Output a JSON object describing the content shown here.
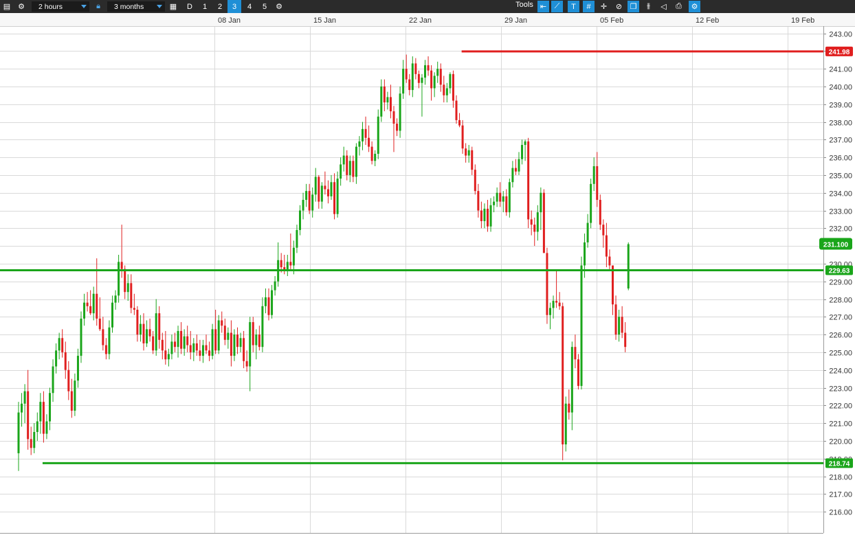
{
  "toolbar": {
    "interval": "2 hours",
    "range": "3 months",
    "periods": [
      "D",
      "1",
      "2",
      "3",
      "4",
      "5"
    ],
    "selected_period": "3",
    "tools_label": "Tools"
  },
  "colors": {
    "up": "#1aa51a",
    "down": "#e01f1f",
    "grid": "#d9d9d9"
  },
  "chart_data": {
    "type": "candlestick",
    "x_labels": [
      "08 Jan",
      "15 Jan",
      "22 Jan",
      "29 Jan",
      "05 Feb",
      "12 Feb",
      "19 Feb"
    ],
    "y_ticks": [
      "243.00",
      "242.00",
      "241.00",
      "240.00",
      "239.00",
      "238.00",
      "237.00",
      "236.00",
      "235.00",
      "234.00",
      "233.00",
      "232.00",
      "231.00",
      "230.00",
      "229.00",
      "228.00",
      "227.00",
      "226.00",
      "225.00",
      "224.00",
      "223.00",
      "222.00",
      "221.00",
      "220.00",
      "219.00",
      "218.00",
      "217.00",
      "216.00"
    ],
    "ylim": [
      215.6,
      243.3
    ],
    "horizontal_lines": [
      {
        "value": 241.98,
        "label": "241.98",
        "color": "#e01f1f",
        "start_candle": 143
      },
      {
        "value": 229.63,
        "label": "229.63",
        "color": "#1aa51a",
        "start_candle": 0
      },
      {
        "value": 218.74,
        "label": "218.74",
        "color": "#1aa51a",
        "start_candle": 9
      }
    ],
    "last_price": {
      "value": 231.1,
      "label": "231.100",
      "color": "#1aa51a"
    },
    "candles": [
      [
        219.3,
        222.2,
        218.3,
        221.6
      ],
      [
        221.6,
        222.7,
        220.8,
        222.1
      ],
      [
        222.1,
        223.2,
        221.0,
        222.8
      ],
      [
        222.8,
        224.0,
        219.5,
        220.1
      ],
      [
        220.1,
        220.8,
        219.2,
        219.6
      ],
      [
        219.6,
        221.0,
        219.3,
        220.5
      ],
      [
        220.5,
        221.6,
        220.0,
        221.1
      ],
      [
        221.1,
        222.7,
        220.4,
        222.2
      ],
      [
        222.2,
        222.8,
        219.9,
        220.4
      ],
      [
        220.4,
        221.5,
        220.1,
        221.1
      ],
      [
        221.1,
        223.0,
        220.6,
        222.7
      ],
      [
        222.7,
        224.6,
        222.2,
        224.2
      ],
      [
        224.2,
        225.5,
        223.8,
        225.1
      ],
      [
        225.1,
        226.1,
        224.6,
        225.8
      ],
      [
        225.8,
        226.3,
        224.7,
        225.0
      ],
      [
        225.0,
        225.6,
        223.5,
        224.0
      ],
      [
        224.0,
        224.5,
        222.3,
        222.8
      ],
      [
        222.8,
        223.5,
        221.3,
        221.7
      ],
      [
        221.7,
        223.8,
        221.4,
        223.4
      ],
      [
        223.4,
        225.2,
        223.0,
        224.8
      ],
      [
        224.8,
        227.3,
        224.4,
        226.9
      ],
      [
        226.9,
        228.3,
        226.5,
        227.8
      ],
      [
        227.8,
        228.4,
        227.3,
        227.6
      ],
      [
        227.6,
        228.5,
        227.1,
        227.2
      ],
      [
        227.2,
        228.7,
        226.8,
        228.3
      ],
      [
        228.3,
        230.3,
        226.5,
        226.9
      ],
      [
        226.9,
        228.1,
        226.2,
        226.3
      ],
      [
        226.3,
        227.0,
        225.1,
        225.4
      ],
      [
        225.4,
        225.8,
        224.6,
        224.9
      ],
      [
        224.9,
        226.8,
        224.6,
        226.4
      ],
      [
        226.4,
        228.2,
        226.1,
        227.8
      ],
      [
        227.8,
        228.5,
        227.4,
        228.2
      ],
      [
        228.2,
        230.5,
        227.8,
        230.1
      ],
      [
        230.1,
        232.2,
        229.2,
        229.7
      ],
      [
        229.7,
        229.9,
        228.0,
        228.4
      ],
      [
        228.4,
        229.4,
        227.9,
        228.9
      ],
      [
        228.9,
        229.4,
        227.2,
        227.5
      ],
      [
        227.5,
        228.3,
        227.1,
        227.4
      ],
      [
        227.4,
        227.6,
        225.6,
        226.0
      ],
      [
        226.0,
        227.1,
        225.6,
        226.6
      ],
      [
        226.6,
        227.2,
        225.1,
        225.5
      ],
      [
        225.5,
        226.8,
        225.3,
        226.3
      ],
      [
        226.3,
        226.9,
        225.6,
        225.9
      ],
      [
        225.9,
        226.2,
        224.9,
        225.1
      ],
      [
        225.1,
        228.0,
        224.8,
        227.2
      ],
      [
        227.2,
        227.6,
        225.2,
        225.7
      ],
      [
        225.7,
        226.1,
        224.6,
        225.1
      ],
      [
        225.1,
        226.2,
        224.3,
        224.6
      ],
      [
        224.6,
        225.2,
        224.2,
        224.9
      ],
      [
        224.9,
        226.0,
        224.6,
        225.6
      ],
      [
        225.6,
        226.1,
        225.0,
        225.3
      ],
      [
        225.3,
        226.5,
        224.7,
        226.2
      ],
      [
        226.2,
        226.7,
        224.9,
        225.2
      ],
      [
        225.2,
        226.3,
        224.8,
        225.9
      ],
      [
        225.9,
        226.5,
        225.0,
        225.4
      ],
      [
        225.4,
        226.2,
        224.6,
        225.0
      ],
      [
        225.0,
        225.8,
        224.5,
        225.5
      ],
      [
        225.5,
        226.0,
        224.8,
        225.1
      ],
      [
        225.1,
        225.7,
        224.5,
        224.8
      ],
      [
        224.8,
        225.7,
        224.4,
        225.4
      ],
      [
        225.4,
        226.0,
        224.9,
        225.1
      ],
      [
        225.1,
        225.6,
        224.5,
        224.8
      ],
      [
        224.8,
        226.6,
        224.6,
        226.3
      ],
      [
        226.3,
        227.4,
        224.9,
        225.1
      ],
      [
        225.1,
        227.1,
        224.9,
        226.8
      ],
      [
        226.8,
        227.3,
        226.1,
        226.5
      ],
      [
        226.5,
        226.9,
        225.4,
        225.7
      ],
      [
        225.7,
        226.4,
        225.2,
        226.1
      ],
      [
        226.1,
        226.8,
        224.2,
        224.8
      ],
      [
        224.8,
        226.3,
        224.5,
        226.0
      ],
      [
        226.0,
        226.4,
        224.9,
        225.3
      ],
      [
        225.3,
        226.1,
        225.0,
        225.8
      ],
      [
        225.8,
        226.2,
        224.1,
        224.5
      ],
      [
        224.5,
        225.1,
        223.9,
        224.2
      ],
      [
        224.2,
        227.0,
        222.8,
        226.7
      ],
      [
        226.7,
        227.0,
        225.0,
        225.4
      ],
      [
        225.4,
        226.3,
        224.6,
        226.0
      ],
      [
        226.0,
        226.5,
        225.1,
        225.3
      ],
      [
        225.3,
        228.1,
        225.0,
        227.6
      ],
      [
        227.6,
        228.6,
        227.2,
        228.1
      ],
      [
        228.1,
        228.6,
        226.8,
        227.1
      ],
      [
        227.1,
        228.8,
        226.9,
        228.5
      ],
      [
        228.5,
        229.3,
        228.2,
        229.0
      ],
      [
        229.0,
        231.2,
        228.7,
        230.2
      ],
      [
        230.2,
        230.6,
        229.5,
        229.8
      ],
      [
        229.8,
        230.5,
        229.4,
        229.6
      ],
      [
        229.6,
        230.5,
        229.3,
        230.1
      ],
      [
        230.1,
        231.7,
        229.6,
        229.9
      ],
      [
        229.9,
        231.3,
        229.4,
        230.9
      ],
      [
        230.9,
        232.2,
        230.6,
        231.9
      ],
      [
        231.9,
        233.3,
        231.6,
        233.0
      ],
      [
        233.0,
        234.0,
        232.5,
        233.6
      ],
      [
        233.6,
        234.5,
        233.2,
        234.1
      ],
      [
        234.1,
        234.5,
        232.8,
        233.0
      ],
      [
        233.0,
        234.3,
        232.6,
        233.9
      ],
      [
        233.9,
        235.4,
        233.5,
        234.9
      ],
      [
        234.9,
        235.0,
        233.1,
        233.5
      ],
      [
        233.5,
        234.6,
        233.1,
        234.4
      ],
      [
        234.4,
        235.2,
        233.9,
        234.2
      ],
      [
        234.2,
        234.7,
        233.4,
        233.8
      ],
      [
        233.8,
        235.0,
        233.6,
        234.6
      ],
      [
        234.6,
        235.1,
        232.5,
        232.8
      ],
      [
        232.8,
        235.2,
        232.6,
        234.8
      ],
      [
        234.8,
        236.0,
        234.4,
        235.6
      ],
      [
        235.6,
        236.6,
        235.2,
        236.1
      ],
      [
        236.1,
        236.4,
        234.7,
        235.0
      ],
      [
        235.0,
        236.1,
        234.6,
        235.8
      ],
      [
        235.8,
        236.1,
        234.6,
        234.9
      ],
      [
        234.9,
        236.8,
        234.5,
        236.6
      ],
      [
        236.6,
        237.2,
        236.1,
        236.9
      ],
      [
        236.9,
        238.0,
        236.4,
        237.6
      ],
      [
        237.6,
        238.3,
        236.7,
        237.1
      ],
      [
        237.1,
        237.8,
        236.3,
        236.6
      ],
      [
        236.6,
        236.9,
        235.6,
        235.8
      ],
      [
        235.8,
        236.4,
        235.5,
        236.2
      ],
      [
        236.2,
        238.7,
        235.9,
        238.3
      ],
      [
        238.3,
        240.4,
        238.0,
        240.0
      ],
      [
        240.0,
        240.4,
        238.6,
        239.1
      ],
      [
        239.1,
        239.7,
        238.7,
        239.4
      ],
      [
        239.4,
        240.1,
        238.2,
        238.6
      ],
      [
        238.6,
        238.9,
        236.3,
        237.9
      ],
      [
        237.9,
        238.2,
        237.2,
        237.5
      ],
      [
        237.5,
        240.0,
        237.1,
        239.6
      ],
      [
        239.6,
        241.5,
        239.3,
        241.0
      ],
      [
        241.0,
        241.8,
        240.2,
        240.4
      ],
      [
        240.4,
        240.7,
        239.5,
        239.8
      ],
      [
        239.8,
        241.7,
        239.4,
        241.3
      ],
      [
        241.3,
        241.6,
        240.4,
        240.7
      ],
      [
        240.7,
        240.9,
        239.9,
        240.2
      ],
      [
        240.2,
        240.7,
        238.3,
        240.5
      ],
      [
        240.5,
        241.5,
        240.1,
        241.2
      ],
      [
        241.2,
        241.7,
        240.6,
        240.9
      ],
      [
        240.9,
        241.2,
        239.2,
        239.9
      ],
      [
        239.9,
        240.8,
        239.4,
        240.6
      ],
      [
        240.6,
        241.4,
        240.2,
        241.0
      ],
      [
        241.0,
        241.3,
        239.7,
        240.1
      ],
      [
        240.1,
        240.6,
        239.1,
        239.5
      ],
      [
        239.5,
        240.2,
        239.1,
        239.9
      ],
      [
        239.9,
        240.8,
        239.6,
        240.7
      ],
      [
        240.7,
        240.9,
        238.8,
        239.2
      ],
      [
        239.2,
        239.5,
        237.9,
        238.1
      ],
      [
        238.1,
        238.5,
        237.7,
        237.8
      ],
      [
        237.8,
        238.1,
        236.2,
        236.5
      ],
      [
        236.5,
        236.8,
        235.7,
        236.1
      ],
      [
        236.1,
        236.7,
        235.7,
        236.4
      ],
      [
        236.4,
        236.6,
        235.0,
        235.3
      ],
      [
        235.3,
        235.6,
        233.9,
        234.1
      ],
      [
        234.1,
        234.5,
        232.6,
        233.0
      ],
      [
        233.0,
        233.5,
        232.0,
        232.4
      ],
      [
        232.4,
        233.4,
        232.0,
        233.1
      ],
      [
        233.1,
        233.6,
        231.8,
        232.1
      ],
      [
        232.1,
        233.7,
        231.8,
        233.3
      ],
      [
        233.3,
        233.8,
        232.9,
        233.5
      ],
      [
        233.5,
        234.3,
        233.2,
        234.0
      ],
      [
        234.0,
        234.6,
        233.2,
        233.5
      ],
      [
        233.5,
        234.1,
        232.9,
        233.8
      ],
      [
        233.8,
        234.2,
        232.7,
        232.9
      ],
      [
        232.9,
        234.8,
        232.6,
        234.6
      ],
      [
        234.6,
        235.8,
        234.3,
        235.4
      ],
      [
        235.4,
        235.9,
        235.0,
        235.2
      ],
      [
        235.2,
        236.3,
        235.0,
        235.9
      ],
      [
        235.9,
        237.0,
        235.6,
        236.7
      ],
      [
        236.7,
        237.0,
        235.8,
        236.9
      ],
      [
        236.9,
        237.1,
        232.0,
        232.5
      ],
      [
        232.5,
        233.0,
        231.6,
        232.2
      ],
      [
        232.2,
        232.6,
        231.0,
        231.8
      ],
      [
        231.8,
        233.3,
        231.3,
        232.9
      ],
      [
        232.9,
        234.3,
        231.9,
        234.0
      ],
      [
        234.0,
        234.2,
        231.5,
        230.6
      ],
      [
        230.6,
        230.9,
        226.6,
        227.1
      ],
      [
        227.1,
        227.8,
        226.3,
        227.5
      ],
      [
        227.5,
        228.2,
        226.9,
        227.9
      ],
      [
        227.9,
        229.6,
        227.5,
        227.8
      ],
      [
        227.8,
        228.4,
        227.4,
        227.6
      ],
      [
        227.6,
        227.8,
        218.9,
        219.8
      ],
      [
        219.8,
        222.5,
        219.4,
        222.1
      ],
      [
        222.1,
        222.9,
        221.2,
        221.6
      ],
      [
        221.6,
        225.6,
        220.6,
        225.3
      ],
      [
        225.3,
        226.0,
        224.1,
        224.6
      ],
      [
        224.6,
        224.9,
        222.9,
        223.1
      ],
      [
        223.1,
        230.4,
        222.9,
        229.9
      ],
      [
        229.9,
        231.7,
        229.2,
        231.2
      ],
      [
        231.2,
        232.8,
        230.9,
        232.3
      ],
      [
        232.3,
        234.8,
        232.0,
        234.5
      ],
      [
        234.5,
        236.0,
        234.1,
        235.5
      ],
      [
        235.5,
        236.3,
        233.2,
        233.6
      ],
      [
        233.6,
        233.9,
        231.9,
        232.2
      ],
      [
        232.2,
        232.5,
        230.9,
        231.6
      ],
      [
        231.6,
        232.3,
        229.8,
        230.4
      ],
      [
        230.4,
        230.8,
        229.6,
        229.9
      ],
      [
        229.9,
        229.6,
        227.1,
        227.7
      ],
      [
        227.7,
        228.2,
        225.7,
        226.0
      ],
      [
        226.0,
        227.4,
        225.6,
        227.0
      ],
      [
        227.0,
        227.6,
        225.8,
        226.1
      ],
      [
        226.1,
        226.7,
        225.0,
        225.3
      ],
      [
        228.6,
        231.2,
        228.5,
        231.1
      ]
    ]
  }
}
